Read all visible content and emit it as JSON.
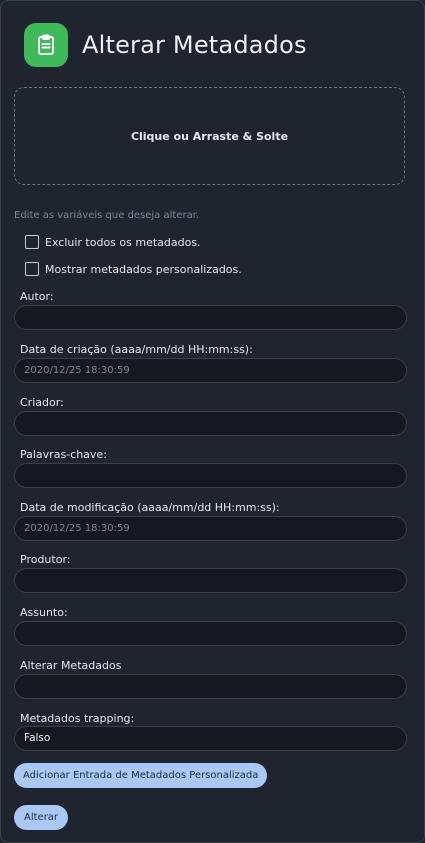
{
  "header": {
    "title": "Alterar Metadados",
    "icon": "clipboard-icon",
    "icon_color": "#3fba5a"
  },
  "dropzone": {
    "label": "Clique ou Arraste & Solte"
  },
  "hint": "Edite as variáveis que deseja alterar.",
  "checkboxes": [
    {
      "label": "Excluir todos os metadados.",
      "checked": false
    },
    {
      "label": "Mostrar metadados personalizados.",
      "checked": false
    }
  ],
  "fields": {
    "author": {
      "label": "Autor:",
      "value": ""
    },
    "creation_date": {
      "label": "Data de criação (aaaa/mm/dd HH:mm:ss):",
      "placeholder": "2020/12/25 18:30:59"
    },
    "creator": {
      "label": "Criador:",
      "value": ""
    },
    "keywords": {
      "label": "Palavras-chave:",
      "value": ""
    },
    "modification_date": {
      "label": "Data de modificação (aaaa/mm/dd HH:mm:ss):",
      "placeholder": "2020/12/25 18:30:59"
    },
    "producer": {
      "label": "Produtor:",
      "value": ""
    },
    "subject": {
      "label": "Assunto:",
      "value": ""
    },
    "title": {
      "label": "Alterar Metadados",
      "value": ""
    },
    "trapping": {
      "label": "Metadados trapping:",
      "value": "Falso"
    }
  },
  "buttons": {
    "add_custom": "Adicionar Entrada de Metadados Personalizada",
    "submit": "Alterar"
  },
  "colors": {
    "background": "#1f242e",
    "input_bg": "#15181e",
    "button_bg": "#a9c8f5",
    "accent_green": "#3fba5a"
  }
}
